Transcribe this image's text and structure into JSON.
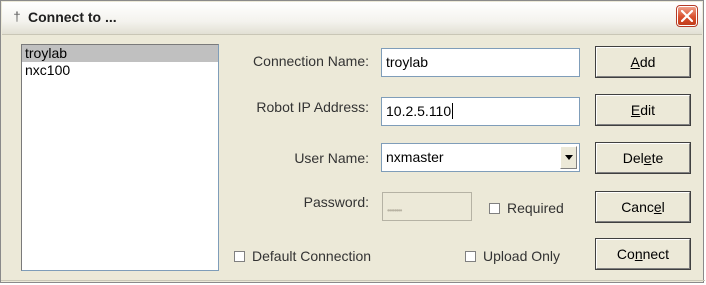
{
  "window": {
    "title": "Connect to ..."
  },
  "connections": {
    "items": [
      "troylab",
      "nxc100"
    ],
    "selected_index": 0
  },
  "form": {
    "connection_name_label": "Connection Name:",
    "connection_name_value": "troylab",
    "robot_ip_label": "Robot IP Address:",
    "robot_ip_value": "10.2.5.110",
    "user_name_label": "User Name:",
    "user_name_value": "nxmaster",
    "password_label": "Password:",
    "password_value": "••••••••",
    "required_label": "Required",
    "default_connection_label": "Default Connection",
    "upload_only_label": "Upload Only"
  },
  "buttons": {
    "add": {
      "pre": "",
      "key": "A",
      "post": "dd"
    },
    "edit": {
      "pre": "",
      "key": "E",
      "post": "dit"
    },
    "delete": {
      "pre": "Del",
      "key": "e",
      "post": "te"
    },
    "cancel": {
      "pre": "Canc",
      "key": "e",
      "post": "l"
    },
    "connect": {
      "pre": "Co",
      "key": "n",
      "post": "nect"
    }
  },
  "icons": {
    "app": "pin-icon",
    "close": "close-icon",
    "dropdown": "chevron-down-icon"
  },
  "colors": {
    "close_button": "#d9502e",
    "selected_row": "#c0c0c0",
    "dialog_bg": "#ece9d8"
  }
}
